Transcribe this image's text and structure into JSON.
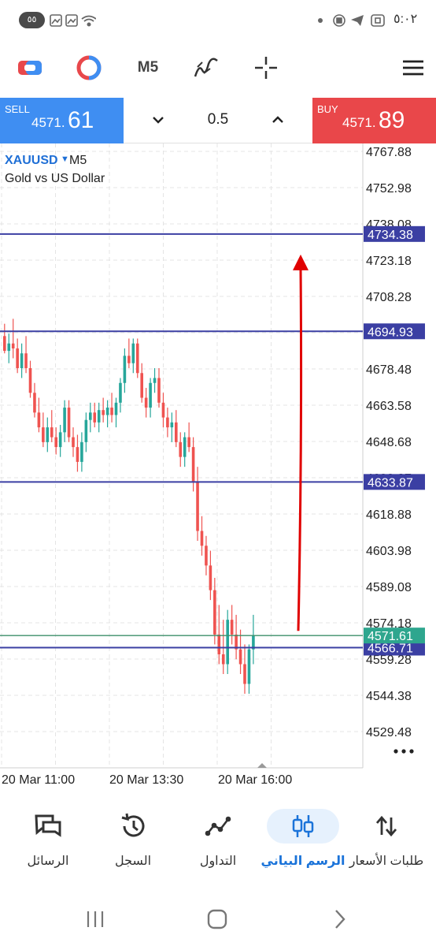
{
  "status_bar": {
    "left_badge": "٥٥",
    "time": "٥:٠٢"
  },
  "toolbar": {
    "timeframe": "M5",
    "icons": [
      "trade-toggle-icon",
      "indicators-icon",
      "timeframe",
      "draw-icon",
      "crosshair-icon",
      "menu-icon"
    ]
  },
  "trade_panel": {
    "sell_label": "SELL",
    "sell_price_small": "4571.",
    "sell_price_big": "61",
    "buy_label": "BUY",
    "buy_price_small": "4571.",
    "buy_price_big": "89",
    "volume": "0.5"
  },
  "chart": {
    "symbol": "XAUUSD",
    "timeframe": "M5",
    "description": "Gold vs US Dollar",
    "colors": {
      "bull": "#26a69a",
      "bear": "#ef5350",
      "hline": "#3b3fa3",
      "price_line": "#3c8f6a",
      "arrow": "#e00000"
    }
  },
  "chart_data": {
    "type": "candlestick",
    "y_ticks": [
      "4767.88",
      "4752.98",
      "4738.08",
      "4723.18",
      "4708.28",
      "4694.93",
      "4678.48",
      "4663.58",
      "4648.68",
      "4633.87",
      "4618.88",
      "4603.98",
      "4589.08",
      "4574.18",
      "4559.28",
      "4544.38",
      "4529.48"
    ],
    "x_ticks": [
      "20 Mar 11:00",
      "20 Mar 13:30",
      "20 Mar 16:00"
    ],
    "ylim": [
      4525,
      4775
    ],
    "grid": true,
    "horizontal_lines": [
      {
        "label": "4734.38",
        "value": 4734.38
      },
      {
        "label": "4694.93",
        "value": 4694.93
      },
      {
        "label": "4633.87",
        "value": 4633.87
      },
      {
        "label": "4566.71",
        "value": 4566.71
      }
    ],
    "current_price": {
      "label": "4571.61",
      "value": 4571.61
    },
    "arrow": {
      "from": 4573.5,
      "to": 4723.5
    },
    "candles": [
      [
        4693,
        4698,
        4686,
        4687
      ],
      [
        4687,
        4694,
        4682,
        4690
      ],
      [
        4690,
        4700,
        4684,
        4688
      ],
      [
        4688,
        4692,
        4678,
        4680
      ],
      [
        4680,
        4690,
        4676,
        4686
      ],
      [
        4686,
        4693,
        4678,
        4680
      ],
      [
        4680,
        4683,
        4668,
        4670
      ],
      [
        4670,
        4674,
        4660,
        4662
      ],
      [
        4662,
        4668,
        4654,
        4656
      ],
      [
        4656,
        4662,
        4648,
        4650
      ],
      [
        4650,
        4660,
        4646,
        4656
      ],
      [
        4656,
        4663,
        4650,
        4652
      ],
      [
        4652,
        4656,
        4645,
        4648
      ],
      [
        4648,
        4657,
        4644,
        4654
      ],
      [
        4654,
        4667,
        4650,
        4664
      ],
      [
        4664,
        4667,
        4650,
        4652
      ],
      [
        4652,
        4656,
        4644,
        4648
      ],
      [
        4648,
        4653,
        4638,
        4642
      ],
      [
        4642,
        4654,
        4638,
        4650
      ],
      [
        4650,
        4662,
        4646,
        4659
      ],
      [
        4659,
        4666,
        4654,
        4662
      ],
      [
        4662,
        4666,
        4656,
        4658
      ],
      [
        4658,
        4666,
        4654,
        4663
      ],
      [
        4663,
        4668,
        4658,
        4661
      ],
      [
        4661,
        4667,
        4656,
        4664
      ],
      [
        4664,
        4670,
        4658,
        4661
      ],
      [
        4661,
        4668,
        4656,
        4666
      ],
      [
        4666,
        4676,
        4662,
        4674
      ],
      [
        4674,
        4688,
        4670,
        4685
      ],
      [
        4685,
        4692,
        4680,
        4682
      ],
      [
        4682,
        4692,
        4678,
        4690
      ],
      [
        4690,
        4692,
        4676,
        4678
      ],
      [
        4678,
        4682,
        4666,
        4668
      ],
      [
        4668,
        4672,
        4660,
        4664
      ],
      [
        4664,
        4676,
        4660,
        4674
      ],
      [
        4674,
        4680,
        4670,
        4676
      ],
      [
        4676,
        4680,
        4664,
        4666
      ],
      [
        4666,
        4670,
        4656,
        4660
      ],
      [
        4660,
        4664,
        4652,
        4656
      ],
      [
        4656,
        4662,
        4650,
        4658
      ],
      [
        4658,
        4663,
        4648,
        4650
      ],
      [
        4650,
        4654,
        4640,
        4644
      ],
      [
        4644,
        4654,
        4640,
        4652
      ],
      [
        4652,
        4658,
        4646,
        4648
      ],
      [
        4648,
        4652,
        4630,
        4634
      ],
      [
        4634,
        4640,
        4610,
        4614
      ],
      [
        4614,
        4620,
        4604,
        4608
      ],
      [
        4608,
        4612,
        4596,
        4600
      ],
      [
        4600,
        4606,
        4586,
        4590
      ],
      [
        4590,
        4595,
        4568,
        4572
      ],
      [
        4572,
        4584,
        4560,
        4564
      ],
      [
        4564,
        4578,
        4556,
        4560
      ],
      [
        4560,
        4582,
        4556,
        4578
      ],
      [
        4578,
        4584,
        4568,
        4572
      ],
      [
        4572,
        4580,
        4562,
        4566
      ],
      [
        4566,
        4574,
        4556,
        4560
      ],
      [
        4560,
        4568,
        4548,
        4552
      ],
      [
        4552,
        4568,
        4548,
        4566
      ],
      [
        4566,
        4580,
        4560,
        4571.61
      ]
    ]
  },
  "bottom_nav": {
    "items": [
      {
        "label": "الرسائل",
        "icon": "messages-icon",
        "active": false
      },
      {
        "label": "السجل",
        "icon": "history-icon",
        "active": false
      },
      {
        "label": "التداول",
        "icon": "trade-icon",
        "active": false
      },
      {
        "label": "الرسم البياني",
        "icon": "chart-icon",
        "active": true
      },
      {
        "label": "طلبات الأسعار",
        "icon": "quotes-icon",
        "active": false
      }
    ]
  }
}
